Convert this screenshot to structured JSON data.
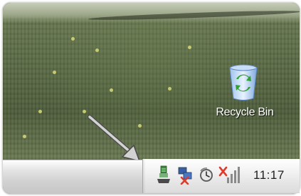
{
  "desktop": {
    "icons": [
      {
        "label": "Recycle Bin",
        "icon": "recycle-bin-icon"
      }
    ]
  },
  "annotation": {
    "icon": "arrow-pointer-icon",
    "color": "#c8c8c8"
  },
  "taskbar": {
    "tray_icons": [
      "usb-device-icon",
      "network-disconnected-icon",
      "clock-sync-icon",
      "wireless-signal-error-icon"
    ],
    "clock": "11:17"
  },
  "colors": {
    "taskbar": "#d2d2d2",
    "tray": "#eeeeee",
    "label_text": "#ffffff",
    "error_red": "#e03a2a"
  }
}
